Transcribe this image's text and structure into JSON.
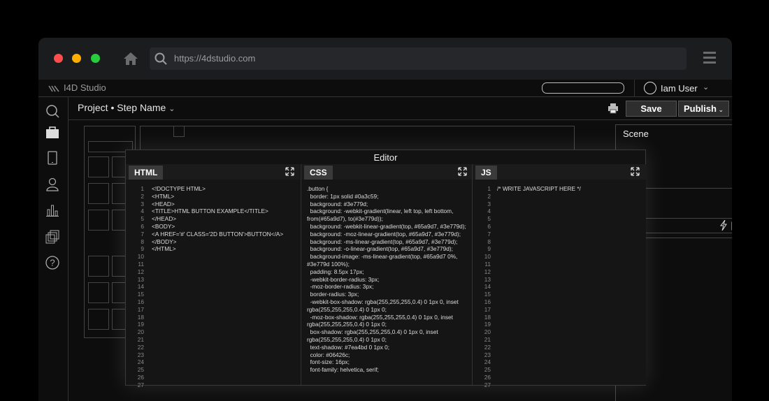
{
  "browser": {
    "url": "https://4dstudio.com"
  },
  "app": {
    "brand": "I4D Studio",
    "user_name": "Iam User"
  },
  "toolbar": {
    "breadcrumb": "Project • Step Name",
    "save_label": "Save",
    "publish_label": "Publish"
  },
  "scene": {
    "label": "Scene"
  },
  "editor": {
    "title": "Editor",
    "html_tab": "HTML",
    "css_tab": "CSS",
    "js_tab": "JS",
    "html_lines": [
      "<!DOCTYPE HTML>",
      "<HTML>",
      "<HEAD>",
      "<TITLE>HTML BUTTON EXAMPLE</TITLE>",
      "</HEAD>",
      "<BODY>",
      "<A HREF='#' CLASS='2D BUTTON'>BUTTON</A>",
      "</BODY>",
      "</HTML>"
    ],
    "css_lines": [
      ".button {",
      "  border: 1px solid #0a3c59;",
      "  background: #3e779d;",
      "  background: -webkit-gradient(linear, left top, left bottom, from(#65a9d7), to(#3e779d));",
      "  background: -webkit-linear-gradient(top, #65a9d7, #3e779d);",
      "  background: -moz-linear-gradient(top, #65a9d7, #3e779d);",
      "  background: -ms-linear-gradient(top, #65a9d7, #3e779d);",
      "  background: -o-linear-gradient(top, #65a9d7, #3e779d);",
      "  background-image: -ms-linear-gradient(top, #65a9d7 0%, #3e779d 100%);",
      "  padding: 8.5px 17px;",
      "  -webkit-border-radius: 3px;",
      "  -moz-border-radius: 3px;",
      "  border-radius: 3px;",
      "  -webkit-box-shadow: rgba(255,255,255,0.4) 0 1px 0, inset rgba(255,255,255,0.4) 0 1px 0;",
      "  -moz-box-shadow: rgba(255,255,255,0.4) 0 1px 0, inset rgba(255,255,255,0.4) 0 1px 0;",
      "  box-shadow: rgba(255,255,255,0.4) 0 1px 0, inset rgba(255,255,255,0.4) 0 1px 0;",
      "  text-shadow: #7ea4bd 0 1px 0;",
      "  color: #06426c;",
      "  font-size: 16px;",
      "  font-family: helvetica, serif;"
    ],
    "js_lines": [
      "/* WRITE JAVASCRIPT HERE */"
    ],
    "line_count": 27
  },
  "icons": {
    "sidebar": [
      "search-icon",
      "briefcase-icon",
      "mobile-icon",
      "user-icon",
      "chart-icon",
      "layers-icon",
      "help-icon"
    ],
    "scene_actions": [
      "lightning-icon",
      "copy-icon",
      "trash-icon"
    ]
  },
  "colors": {
    "close": "#ff4c4c",
    "minimize": "#ffae00",
    "maximize": "#27cd3c"
  }
}
